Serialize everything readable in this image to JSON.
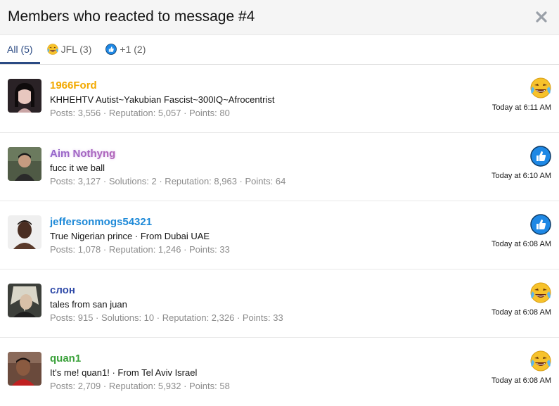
{
  "dialog": {
    "title": "Members who reacted to message #4",
    "close_icon": "close-icon"
  },
  "tabs": [
    {
      "label": "All (5)",
      "icon": null,
      "active": true
    },
    {
      "label": "JFL (3)",
      "icon": "jfl-reaction-icon",
      "active": false
    },
    {
      "label": "+1 (2)",
      "icon": "plus-one-reaction-icon",
      "active": false
    }
  ],
  "members": [
    {
      "name": "1966Ford",
      "name_color": "#f2a900",
      "user_title": "KHHEHTV Autist~Yakubian Fascist~300IQ~Afrocentrist",
      "stats": "Posts: 3,556 · Reputation: 5,057 · Points: 80",
      "reaction": "jfl",
      "time": "Today at 6:11 AM"
    },
    {
      "name": "Aim Nothyng",
      "name_color": "#9b5fc0",
      "user_title": "fucc it we ball",
      "stats": "Posts: 3,127 · Solutions: 2 · Reputation: 8,963 · Points: 64",
      "reaction": "plus-one",
      "time": "Today at 6:10 AM"
    },
    {
      "name": "jeffersonmogs54321",
      "name_color": "#1f8ad8",
      "user_title": "True Nigerian prince · From Dubai UAE",
      "stats": "Posts: 1,078 · Reputation: 1,246 · Points: 33",
      "reaction": "plus-one",
      "time": "Today at 6:08 AM"
    },
    {
      "name": "слон",
      "name_color": "#2f4aa8",
      "user_title": "tales from san juan",
      "stats": "Posts: 915 · Solutions: 10 · Reputation: 2,326 · Points: 33",
      "reaction": "jfl",
      "time": "Today at 6:08 AM"
    },
    {
      "name": "quan1",
      "name_color": "#3aa13a",
      "user_title": "It's me! quan1! · From Tel Aviv Israel",
      "stats": "Posts: 2,709 · Reputation: 5,932 · Points: 58",
      "reaction": "jfl",
      "time": "Today at 6:08 AM"
    }
  ]
}
